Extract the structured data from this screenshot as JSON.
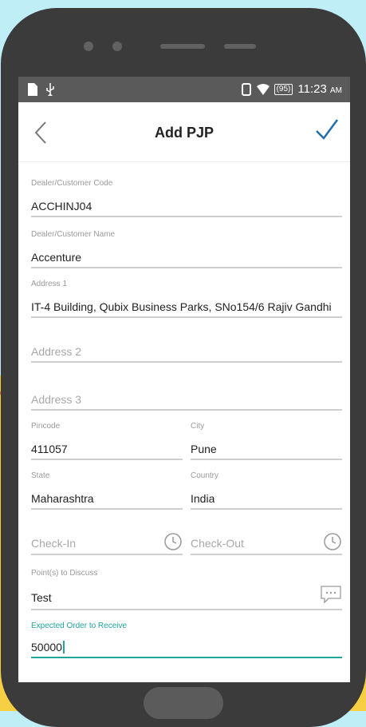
{
  "status_bar": {
    "time": "11:23",
    "ampm": "AM",
    "battery": "(95)"
  },
  "app_bar": {
    "title": "Add PJP"
  },
  "form": {
    "dealer_code": {
      "label": "Dealer/Customer Code",
      "value": "ACCHINJ04"
    },
    "dealer_name": {
      "label": "Dealer/Customer Name",
      "value": "Accenture"
    },
    "address1": {
      "label": "Address 1",
      "value": "IT-4 Building, Qubix Business Parks, SNo154/6 Rajiv Gandhi"
    },
    "address2": {
      "placeholder": "Address 2"
    },
    "address3": {
      "placeholder": "Address 3"
    },
    "pincode": {
      "label": "Pincode",
      "value": "411057"
    },
    "city": {
      "label": "City",
      "value": "Pune"
    },
    "state": {
      "label": "State",
      "value": "Maharashtra"
    },
    "country": {
      "label": "Country",
      "value": "India"
    },
    "check_in": {
      "placeholder": "Check-In"
    },
    "check_out": {
      "placeholder": "Check-Out"
    },
    "points": {
      "label": "Point(s) to Discuss",
      "value": "Test"
    },
    "expected_order": {
      "label": "Expected Order to Receive",
      "value": "50000"
    }
  },
  "colors": {
    "accent": "#1fa59a",
    "status_bar": "#5a5a5a",
    "phone_body": "#3b3b3c",
    "background_top": "#bfeef7",
    "background_bottom": "#f7cf43"
  },
  "icons": [
    "back-arrow-icon",
    "checkmark-icon",
    "clock-icon",
    "chat-bubble-icon",
    "sim-icon",
    "usb-icon",
    "vibrate-icon",
    "wifi-icon",
    "battery-icon"
  ]
}
